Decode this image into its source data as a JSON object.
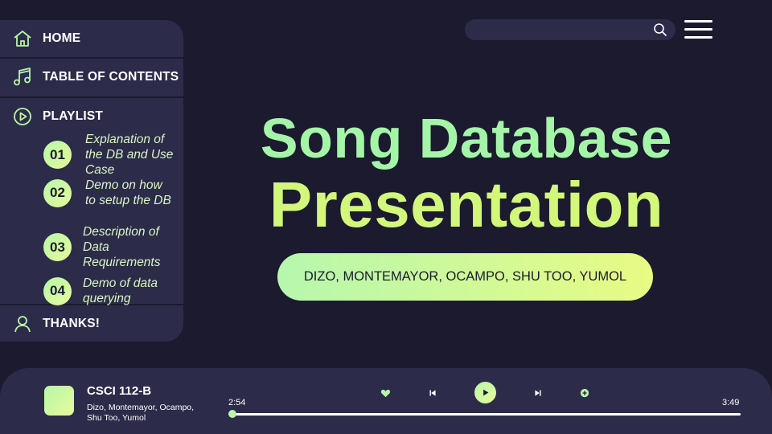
{
  "sidebar": {
    "home": "HOME",
    "toc": "TABLE OF CONTENTS",
    "playlist": "PLAYLIST",
    "items": [
      {
        "num": "01",
        "text": "Explanation of the DB and Use Case"
      },
      {
        "num": "02",
        "text": "Demo on how to setup the DB"
      },
      {
        "num": "03",
        "text": "Description of Data Requirements"
      },
      {
        "num": "04",
        "text": "Demo of data querying"
      }
    ],
    "thanks": "THANKS!"
  },
  "search": {
    "placeholder": ""
  },
  "title": {
    "line1": "Song Database",
    "line2": "Presentation"
  },
  "authors": "DIZO, MONTEMAYOR, OCAMPO, SHU TOO, YUMOL",
  "player": {
    "track_title": "CSCI 112-B",
    "track_artist": "Dizo, Montemayor, Ocampo, Shu Too, Yumol",
    "time_current": "2:54",
    "time_total": "3:49",
    "progress": 0
  },
  "icons": {
    "home": "home-icon",
    "toc": "music-note-icon",
    "playlist": "play-circle-icon",
    "thanks": "user-icon",
    "search": "search-icon",
    "menu": "hamburger-menu-icon"
  },
  "colors": {
    "background": "#1b1a2e",
    "panel": "#2d2b4a",
    "accent_green": "#a5f5a8",
    "accent_lime": "#d2f77a"
  }
}
